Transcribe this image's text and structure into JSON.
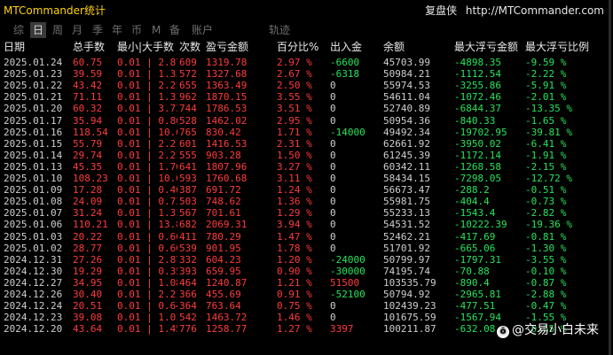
{
  "app_title": "MTCommander统计",
  "header_right": {
    "brand": "复盘侠",
    "url": "http://MTCommander.com"
  },
  "tabs": [
    {
      "label": "综",
      "active": false
    },
    {
      "label": "日",
      "active": true
    },
    {
      "label": "周",
      "active": false
    },
    {
      "label": "月",
      "active": false
    },
    {
      "label": "季",
      "active": false
    },
    {
      "label": "年",
      "active": false
    },
    {
      "label": "币",
      "active": false
    },
    {
      "label": "M",
      "active": false
    },
    {
      "label": "备",
      "active": false
    },
    {
      "label": "账户",
      "active": false
    },
    {
      "label": "轨迹",
      "active": false
    }
  ],
  "columns": [
    "日期",
    "总手数",
    "最小|大手数",
    "次数",
    "盈亏金额",
    "百分比%",
    "出入金",
    "余额",
    "最大浮亏金额",
    "最大浮亏比例"
  ],
  "rows": [
    [
      "2025.01.24",
      "60.75",
      "0.01 | 2.87",
      "609",
      "1319.78",
      "2.97 %",
      "-6600",
      "45703.99",
      "-4898.35",
      "-9.59 %"
    ],
    [
      "2025.01.23",
      "39.59",
      "0.01 | 1.31",
      "572",
      "1327.68",
      "2.67 %",
      "-6318",
      "50984.21",
      "-1112.54",
      "-2.22 %"
    ],
    [
      "2025.01.22",
      "43.42",
      "0.01 | 2.21",
      "655",
      "1363.49",
      "2.50 %",
      "0",
      "55974.53",
      "-3255.86",
      "-5.91 %"
    ],
    [
      "2025.01.21",
      "71.11",
      "0.01 | 1.31",
      "962",
      "1870.15",
      "3.55 %",
      "0",
      "54611.04",
      "-1072.46",
      "-2.01 %"
    ],
    [
      "2025.01.20",
      "60.32",
      "0.01 | 3.73",
      "744",
      "1786.53",
      "3.51 %",
      "0",
      "52740.89",
      "-6844.37",
      "-13.35 %"
    ],
    [
      "2025.01.17",
      "35.94",
      "0.01 | 0.86",
      "528",
      "1462.02",
      "2.95 %",
      "0",
      "50954.36",
      "-840.33",
      "-1.65 %"
    ],
    [
      "2025.01.16",
      "118.54",
      "0.01 | 10.66",
      "765",
      "830.42",
      "1.71 %",
      "-14000",
      "49492.34",
      "-19702.95",
      "-39.81 %"
    ],
    [
      "2025.01.15",
      "55.79",
      "0.01 | 2.21",
      "601",
      "1416.53",
      "2.31 %",
      "0",
      "62661.92",
      "-3950.02",
      "-6.41 %"
    ],
    [
      "2025.01.14",
      "29.74",
      "0.01 | 2.21",
      "555",
      "903.28",
      "1.50 %",
      "0",
      "61245.39",
      "-1172.14",
      "-1.91 %"
    ],
    [
      "2025.01.13",
      "45.35",
      "0.01 | 1.70",
      "641",
      "1807.96",
      "3.27 %",
      "0",
      "60342.11",
      "-1268.58",
      "-2.15 %"
    ],
    [
      "2025.01.10",
      "108.23",
      "0.01 | 10.66",
      "593",
      "1760.68",
      "3.11 %",
      "0",
      "58434.15",
      "-7298.05",
      "-12.72 %"
    ],
    [
      "2025.01.09",
      "17.28",
      "0.01 | 0.46",
      "387",
      "691.72",
      "1.24 %",
      "0",
      "56673.47",
      "-288.2",
      "-0.51 %"
    ],
    [
      "2025.01.08",
      "24.09",
      "0.01 | 0.73",
      "503",
      "748.62",
      "1.36 %",
      "0",
      "55981.75",
      "-404.4",
      "-0.73 %"
    ],
    [
      "2025.01.07",
      "31.24",
      "0.01 | 1.31",
      "567",
      "701.61",
      "1.29 %",
      "0",
      "55233.13",
      "-1543.4",
      "-2.82 %"
    ],
    [
      "2025.01.06",
      "110.21",
      "0.01 | 13.86",
      "682",
      "2069.31",
      "3.94 %",
      "0",
      "54531.52",
      "-10222.39",
      "-19.36 %"
    ],
    [
      "2025.01.03",
      "20.22",
      "0.01 | 0.60",
      "411",
      "780.29",
      "1.47 %",
      "0",
      "52462.21",
      "-417.69",
      "-0.81 %"
    ],
    [
      "2025.01.02",
      "28.77",
      "0.01 | 0.60",
      "539",
      "901.95",
      "1.78 %",
      "0",
      "51701.92",
      "-665.06",
      "-1.30 %"
    ],
    [
      "2024.12.31",
      "27.26",
      "0.01 | 2.87",
      "332",
      "604.23",
      "1.20 %",
      "-24000",
      "50799.97",
      "-1797.31",
      "-3.55 %"
    ],
    [
      "2024.12.30",
      "19.29",
      "0.01 | 0.35",
      "393",
      "659.95",
      "0.90 %",
      "-30000",
      "74195.74",
      "-70.88",
      "-0.10 %"
    ],
    [
      "2024.12.27",
      "34.95",
      "0.01 | 1.08",
      "464",
      "1240.87",
      "1.21 %",
      "51500",
      "103535.79",
      "-890.4",
      "-0.87 %"
    ],
    [
      "2024.12.26",
      "30.40",
      "0.01 | 2.21",
      "366",
      "455.69",
      "0.91 %",
      "-52100",
      "50794.92",
      "-2965.81",
      "-2.88 %"
    ],
    [
      "2024.12.24",
      "20.51",
      "0.01 | 0.64",
      "364",
      "763.64",
      "0.75 %",
      "0",
      "102439.23",
      "-477.51",
      "-0.47 %"
    ],
    [
      "2024.12.23",
      "39.08",
      "0.01 | 1.01",
      "542",
      "1463.72",
      "1.46 %",
      "0",
      "101675.59",
      "-1567.94",
      "-1.55 %"
    ],
    [
      "2024.12.20",
      "43.64",
      "0.01 | 1.45",
      "776",
      "1258.77",
      "1.27 %",
      "3397",
      "100211.87",
      "-632.08",
      "-0.65 %"
    ]
  ],
  "watermark": "@交易小白未来",
  "colors": {
    "title": "#ffd400",
    "positive": "#ff3b3b",
    "negative": "#27e35a",
    "neutral": "#cfcfcf",
    "background": "#000000"
  }
}
